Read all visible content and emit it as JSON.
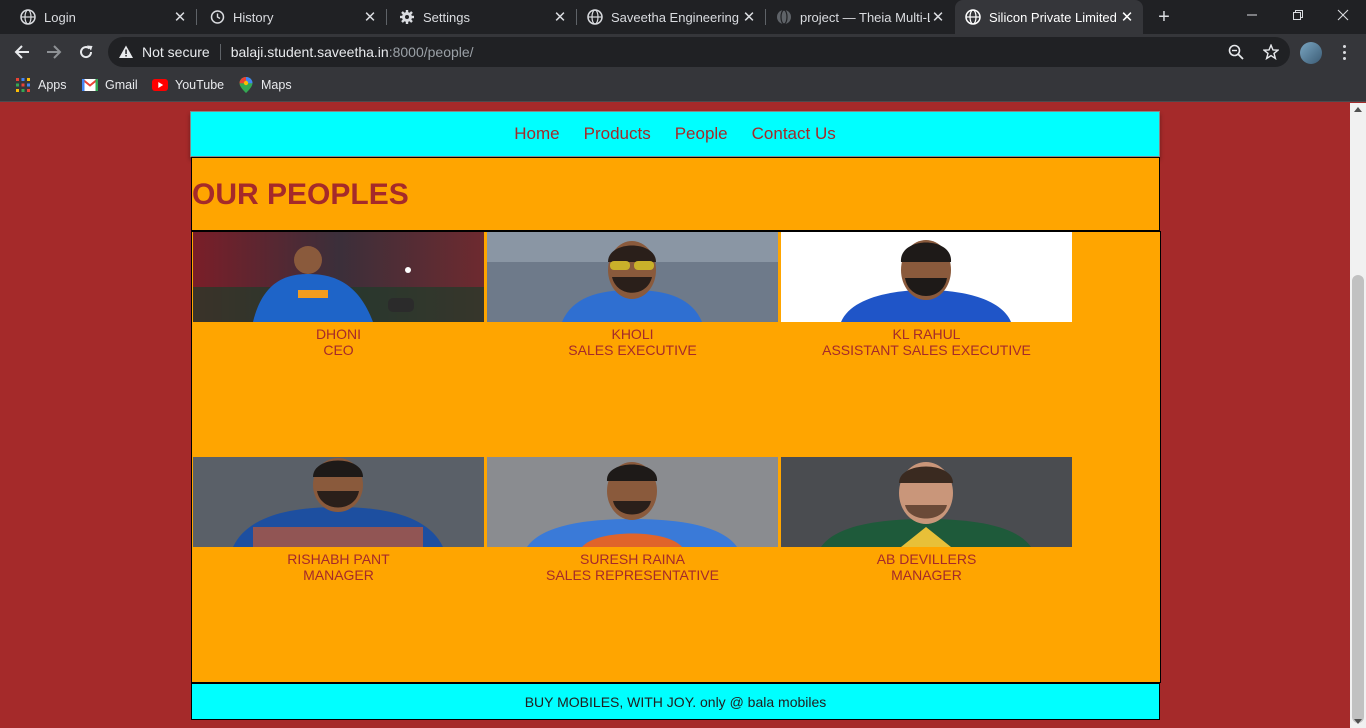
{
  "browser": {
    "tabs": [
      {
        "title": "Login",
        "icon": "globe-icon"
      },
      {
        "title": "History",
        "icon": "history-icon"
      },
      {
        "title": "Settings",
        "icon": "gear-icon"
      },
      {
        "title": "Saveetha Engineering C",
        "icon": "globe-icon"
      },
      {
        "title": "project — Theia Multi-L",
        "icon": "globe-icon"
      },
      {
        "title": "Silicon Private Limited",
        "icon": "globe-icon",
        "active": true
      }
    ],
    "address": {
      "security_label": "Not secure",
      "host": "balaji.student.saveetha.in",
      "path": ":8000/people/"
    },
    "bookmarks": [
      {
        "label": "Apps",
        "icon": "apps-grid-icon"
      },
      {
        "label": "Gmail",
        "icon": "gmail-icon"
      },
      {
        "label": "YouTube",
        "icon": "youtube-icon"
      },
      {
        "label": "Maps",
        "icon": "maps-pin-icon"
      }
    ]
  },
  "site": {
    "colors": {
      "background": "#a52a2a",
      "nav": "#00ffff",
      "content": "#ffa500",
      "text": "#a52a2a"
    },
    "nav": {
      "home": "Home",
      "products": "Products",
      "people": "People",
      "contact": "Contact Us"
    },
    "heading": "OUR PEOPLES",
    "people": [
      {
        "name": "DHONI",
        "role": "CEO"
      },
      {
        "name": "KHOLI",
        "role": "SALES EXECUTIVE"
      },
      {
        "name": "KL RAHUL",
        "role": "ASSISTANT SALES EXECUTIVE"
      },
      {
        "name": "RISHABH PANT",
        "role": "MANAGER"
      },
      {
        "name": "SURESH RAINA",
        "role": "SALES REPRESENTATIVE"
      },
      {
        "name": "AB DEVILLERS",
        "role": "MANAGER"
      }
    ],
    "footer": "BUY MOBILES, WITH JOY. only @ bala mobiles"
  }
}
